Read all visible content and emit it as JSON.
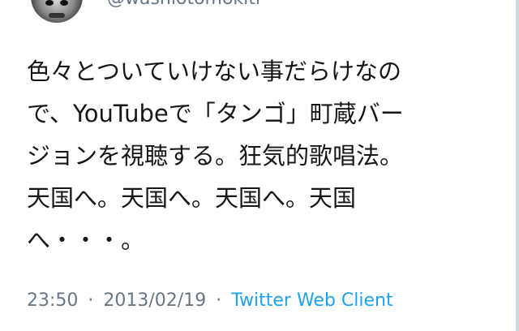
{
  "tweet": {
    "author_handle": "@washiotomokiti",
    "avatar_icon": "user-avatar-icon",
    "text_lines": [
      "色々とついていけない事だらけなの",
      "で、YouTubeで「タンゴ」町蔵バー",
      "ジョンを視聴する。狂気的歌唱法。",
      "天国へ。天国へ。天国へ。天国",
      "へ・・・。"
    ],
    "time": "23:50",
    "date": "2013/02/19",
    "separator": "·",
    "client": "Twitter Web Client"
  },
  "colors": {
    "text": "#14171a",
    "meta": "#657786",
    "link": "#1da1f2"
  }
}
